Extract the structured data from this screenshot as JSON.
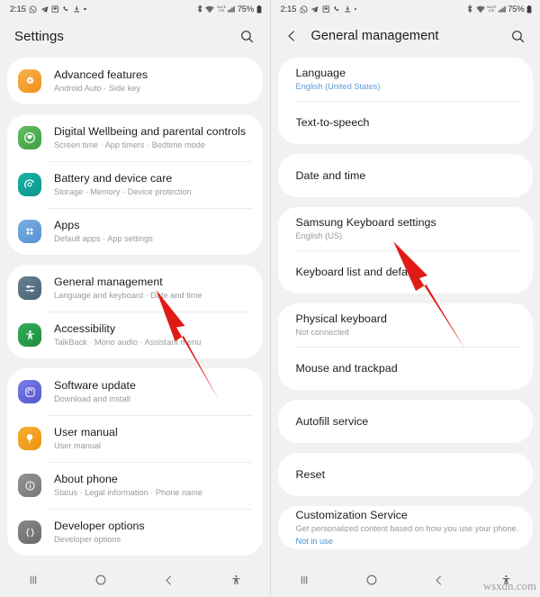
{
  "status_bar": {
    "time": "2:15",
    "left_icons": [
      "whatsapp-icon",
      "telegram-icon",
      "app-icon",
      "phone-call-icon",
      "download-icon",
      "dot-icon"
    ],
    "right_icons": [
      "bluetooth-icon",
      "wifi-icon",
      "lte-icon",
      "signal-icon"
    ],
    "battery_percent": "75%"
  },
  "left_screen": {
    "app_bar": {
      "title": "Settings",
      "search_icon": "search-icon"
    },
    "groups": [
      {
        "items": [
          {
            "title": "Advanced features",
            "subtitle": "Android Auto  ·  Side key",
            "icon": "advanced-features-icon",
            "icon_color": "#f5a93c",
            "icon_color2": "#f09021"
          }
        ]
      },
      {
        "items": [
          {
            "title": "Digital Wellbeing and parental controls",
            "subtitle": "Screen time  ·  App timers  ·  Bedtime mode",
            "icon": "digital-wellbeing-icon",
            "icon_color": "#5cb85c",
            "icon_color2": "#4aa84a"
          },
          {
            "title": "Battery and device care",
            "subtitle": "Storage  ·  Memory  ·  Device protection",
            "icon": "battery-device-care-icon",
            "icon_color": "#13a89e",
            "icon_color2": "#0f9a90"
          },
          {
            "title": "Apps",
            "subtitle": "Default apps  ·  App settings",
            "icon": "apps-icon",
            "icon_color": "#6fa8e0",
            "icon_color2": "#5b97d4"
          }
        ]
      },
      {
        "items": [
          {
            "title": "General management",
            "subtitle": "Language and keyboard  ·  Date and time",
            "icon": "general-management-icon",
            "icon_color": "#5a7387",
            "icon_color2": "#4c6türk"
          },
          {
            "title": "Accessibility",
            "subtitle": "TalkBack  ·  Mono audio  ·  Assistant menu",
            "icon": "accessibility-icon",
            "icon_color": "#2fa24f",
            "icon_color2": "#27913f"
          }
        ]
      },
      {
        "items": [
          {
            "title": "Software update",
            "subtitle": "Download and install",
            "icon": "software-update-icon",
            "icon_color": "#6b6cdf",
            "icon_color2": "#5a5bd0"
          },
          {
            "title": "User manual",
            "subtitle": "User manual",
            "icon": "user-manual-icon",
            "icon_color": "#f5a623",
            "icon_color2": "#e8991a"
          },
          {
            "title": "About phone",
            "subtitle": "Status  ·  Legal information  ·  Phone name",
            "icon": "about-phone-icon",
            "icon_color": "#8a8a8a",
            "icon_color2": "#7b7b7b"
          },
          {
            "title": "Developer options",
            "subtitle": "Developer options",
            "icon": "developer-options-icon",
            "icon_color": "#7a7a7a",
            "icon_color2": "#6d6d6d"
          }
        ]
      }
    ],
    "nav": {
      "recents": "recents-button",
      "home": "home-button",
      "back": "back-button",
      "accessibility": "accessibility-button"
    }
  },
  "right_screen": {
    "app_bar": {
      "back_icon": "back-chevron-icon",
      "title": "General management",
      "search_icon": "search-icon"
    },
    "groups": [
      {
        "items": [
          {
            "title": "Language",
            "subtitle": "English (United States)",
            "subtitle_style": "blue"
          },
          {
            "title": "Text-to-speech",
            "subtitle": ""
          }
        ]
      },
      {
        "items": [
          {
            "title": "Date and time",
            "subtitle": ""
          }
        ]
      },
      {
        "items": [
          {
            "title": "Samsung Keyboard settings",
            "subtitle": "English (US)",
            "subtitle_style": "grey"
          },
          {
            "title": "Keyboard list and default",
            "subtitle": ""
          }
        ]
      },
      {
        "items": [
          {
            "title": "Physical keyboard",
            "subtitle": "Not connected",
            "subtitle_style": "grey"
          },
          {
            "title": "Mouse and trackpad",
            "subtitle": ""
          }
        ]
      },
      {
        "items": [
          {
            "title": "Autofill service",
            "subtitle": ""
          }
        ]
      },
      {
        "items": [
          {
            "title": "Reset",
            "subtitle": ""
          }
        ]
      },
      {
        "items": [
          {
            "title": "Customization Service",
            "subtitle": "Get personalized content based on how you use your phone.",
            "subtitle2": "Not in use",
            "subtitle_style": "grey"
          }
        ]
      }
    ],
    "nav": {
      "recents": "recents-button",
      "home": "home-button",
      "back": "back-button",
      "accessibility": "accessibility-button"
    }
  },
  "annotations": {
    "arrow_color": "#e01b17",
    "arrows": [
      {
        "name": "arrow-pointing-general-management"
      },
      {
        "name": "arrow-pointing-samsung-keyboard-settings"
      }
    ]
  },
  "watermark": "wsxdn.com"
}
